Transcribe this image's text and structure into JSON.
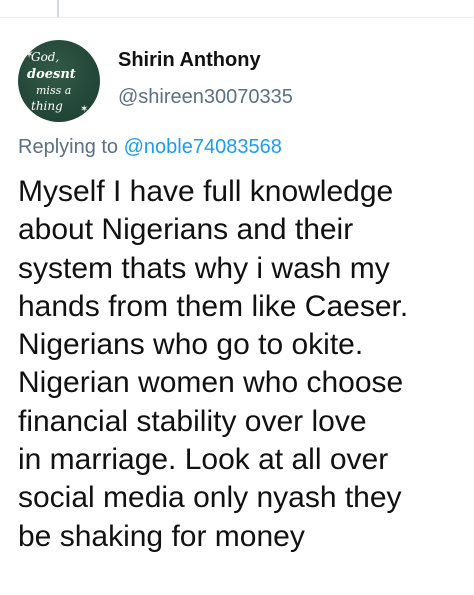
{
  "tweet": {
    "author": {
      "display_name": "Shirin Anthony",
      "handle": "@shireen30070335",
      "avatar_text": {
        "line1": "God,",
        "line2": "doesnt",
        "line3": "miss a",
        "line4": "thing"
      }
    },
    "replying_to": {
      "prefix": "Replying to",
      "mention": "@noble74083568"
    },
    "body": "Myself I have full knowledge\nabout Nigerians and their\nsystem thats why i wash my\nhands from them like Caeser.\nNigerians who go to okite.\nNigerian women who choose\nfinancial stability over love\nin marriage. Look at all over\nsocial media only nyash they\nbe shaking for money"
  },
  "colors": {
    "mention": "#1d9bf0",
    "secondary_text": "#5b7083",
    "avatar_bg": "#24493a"
  }
}
